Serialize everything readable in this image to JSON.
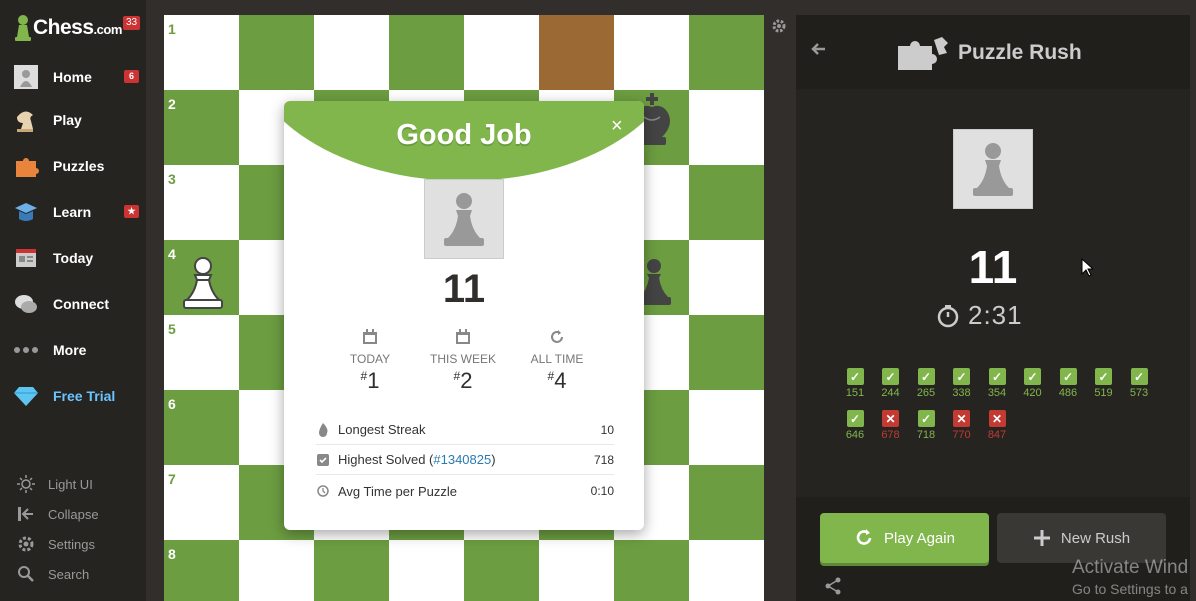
{
  "sidebar": {
    "logo_text": "Chess",
    "logo_suffix": ".com",
    "logo_badge": "33",
    "items": [
      {
        "label": "Home",
        "icon": "home-avatar-icon",
        "badge": "6"
      },
      {
        "label": "Play",
        "icon": "play-icon",
        "badge": ""
      },
      {
        "label": "Puzzles",
        "icon": "puzzles-icon",
        "badge": ""
      },
      {
        "label": "Learn",
        "icon": "learn-icon",
        "badge": "★"
      },
      {
        "label": "Today",
        "icon": "today-icon",
        "badge": ""
      },
      {
        "label": "Connect",
        "icon": "connect-icon",
        "badge": ""
      },
      {
        "label": "More",
        "icon": "more-icon",
        "badge": ""
      },
      {
        "label": "Free Trial",
        "icon": "diamond-icon",
        "badge": ""
      }
    ],
    "footer": [
      {
        "label": "Light UI",
        "icon": "sun-icon"
      },
      {
        "label": "Collapse",
        "icon": "collapse-icon"
      },
      {
        "label": "Settings",
        "icon": "gear-icon"
      },
      {
        "label": "Search",
        "icon": "search-icon"
      }
    ]
  },
  "board": {
    "ranks": [
      "1",
      "2",
      "3",
      "4",
      "5",
      "6",
      "7",
      "8"
    ],
    "light_color": "#ffffff",
    "dark_color": "#6c9d41",
    "highlight_color": "#9b6a34"
  },
  "modal": {
    "title": "Good Job",
    "close": "×",
    "score": "11",
    "ranks": [
      {
        "label": "TODAY",
        "value": "1"
      },
      {
        "label": "THIS WEEK",
        "value": "2"
      },
      {
        "label": "ALL TIME",
        "value": "4"
      }
    ],
    "stats": {
      "streak_label": "Longest Streak",
      "streak_value": "10",
      "highest_label": "Highest Solved (",
      "highest_link": "#1340825",
      "highest_close": ")",
      "highest_value": "718",
      "avg_label": "Avg Time per Puzzle",
      "avg_value": "0:10"
    }
  },
  "panel": {
    "title": "Puzzle Rush",
    "score": "11",
    "timer": "2:31",
    "results": [
      {
        "value": "151",
        "ok": true
      },
      {
        "value": "244",
        "ok": true
      },
      {
        "value": "265",
        "ok": true
      },
      {
        "value": "338",
        "ok": true
      },
      {
        "value": "354",
        "ok": true
      },
      {
        "value": "420",
        "ok": true
      },
      {
        "value": "486",
        "ok": true
      },
      {
        "value": "519",
        "ok": true
      },
      {
        "value": "573",
        "ok": true
      },
      {
        "value": "646",
        "ok": true
      },
      {
        "value": "678",
        "ok": false
      },
      {
        "value": "718",
        "ok": true
      },
      {
        "value": "770",
        "ok": false
      },
      {
        "value": "847",
        "ok": false
      }
    ],
    "play_again": "Play Again",
    "new_rush": "New Rush"
  },
  "watermark": {
    "line1": "Activate Wind",
    "line2": "Go to Settings to a"
  },
  "colors": {
    "accent": "#81b64c",
    "error": "#c33a32"
  }
}
